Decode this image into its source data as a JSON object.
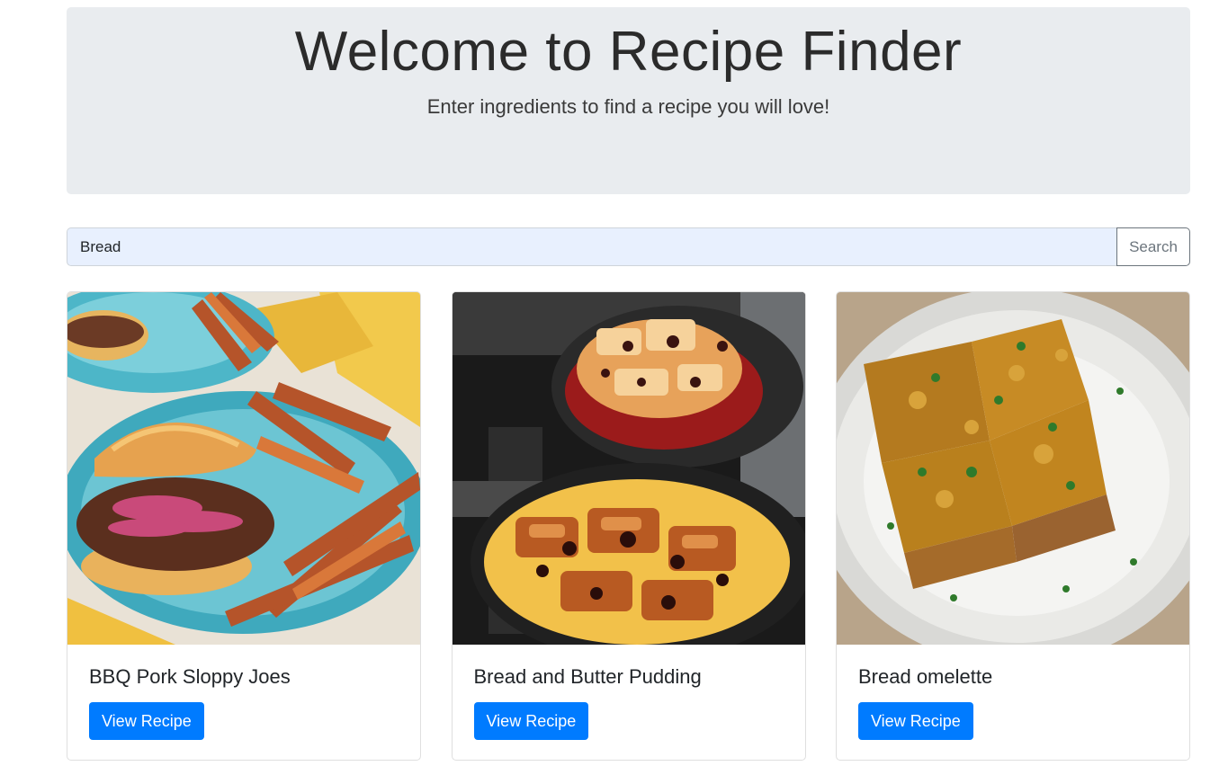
{
  "header": {
    "title": "Welcome to Recipe Finder",
    "subtitle": "Enter ingredients to find a recipe you will love!"
  },
  "search": {
    "value": "Bread",
    "button_label": "Search"
  },
  "recipes": [
    {
      "title": "BBQ Pork Sloppy Joes",
      "button_label": "View Recipe"
    },
    {
      "title": "Bread and Butter Pudding",
      "button_label": "View Recipe"
    },
    {
      "title": "Bread omelette",
      "button_label": "View Recipe"
    }
  ],
  "colors": {
    "primary": "#007bff",
    "jumbotron_bg": "#e9ecef",
    "input_autofill_bg": "#e8f0fe"
  }
}
